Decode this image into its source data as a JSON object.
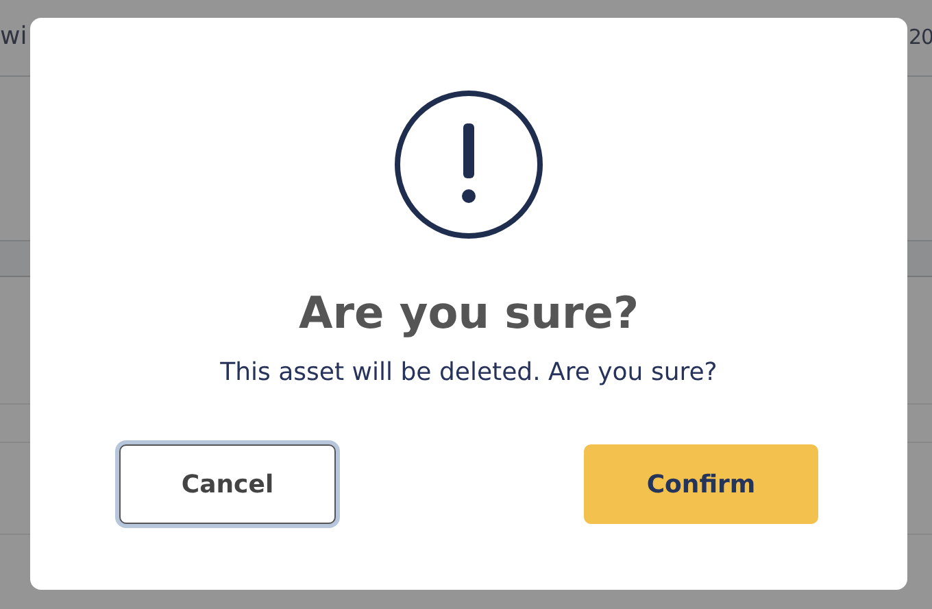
{
  "background": {
    "left_text": "wi",
    "right_text": "20"
  },
  "dialog": {
    "title": "Are you sure?",
    "message": "This asset will be deleted. Are you sure?",
    "buttons": [
      {
        "label": "Cancel",
        "kind": "secondary",
        "focused": true
      },
      {
        "label": "Confirm",
        "kind": "primary",
        "focused": false
      }
    ]
  }
}
